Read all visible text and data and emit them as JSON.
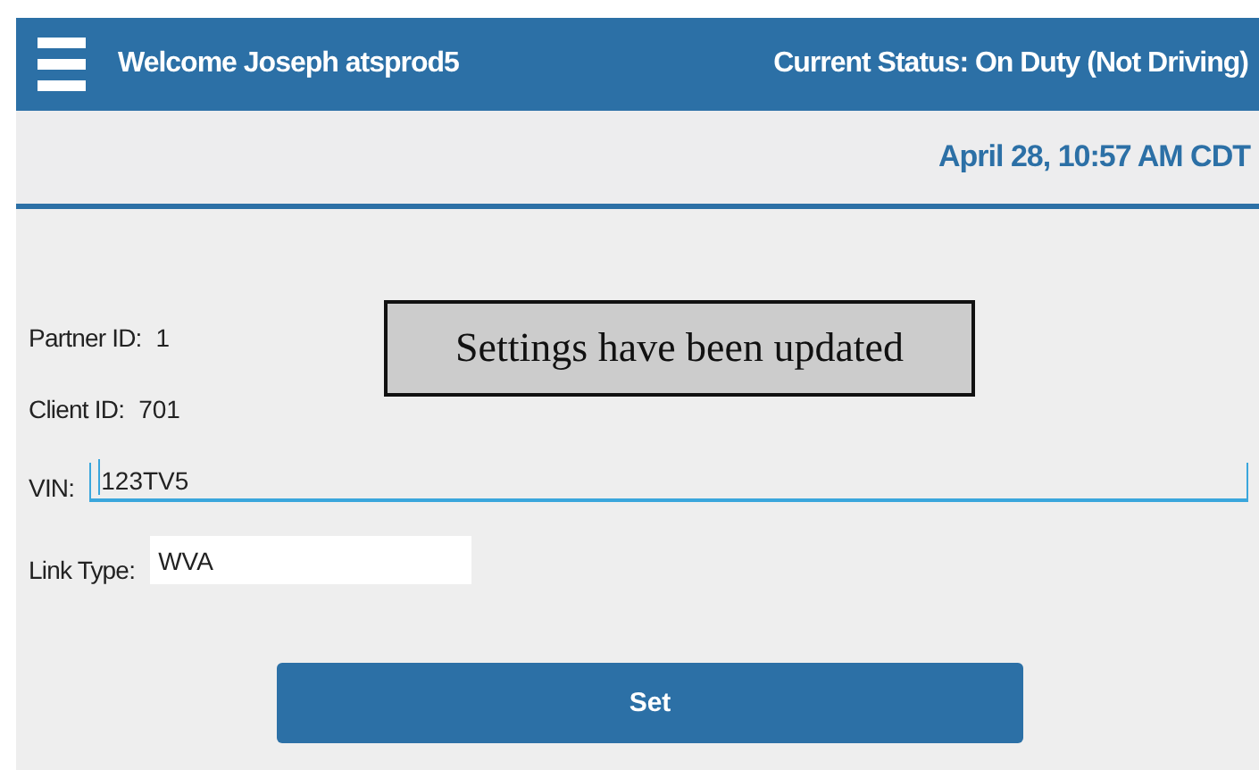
{
  "header": {
    "welcome": "Welcome Joseph atsprod5",
    "status": "Current Status: On Duty (Not Driving)"
  },
  "date": "April 28, 10:57 AM CDT",
  "fields": [
    {
      "kind": "text",
      "label": "Partner ID:",
      "value": "1"
    },
    {
      "kind": "text",
      "label": "Client ID:",
      "value": "701"
    },
    {
      "kind": "underline",
      "label": "VIN:",
      "value": "123TV5"
    },
    {
      "kind": "box",
      "label": "Link Type:",
      "value": "WVA"
    }
  ],
  "toast": "Settings have been updated",
  "button": "Set"
}
